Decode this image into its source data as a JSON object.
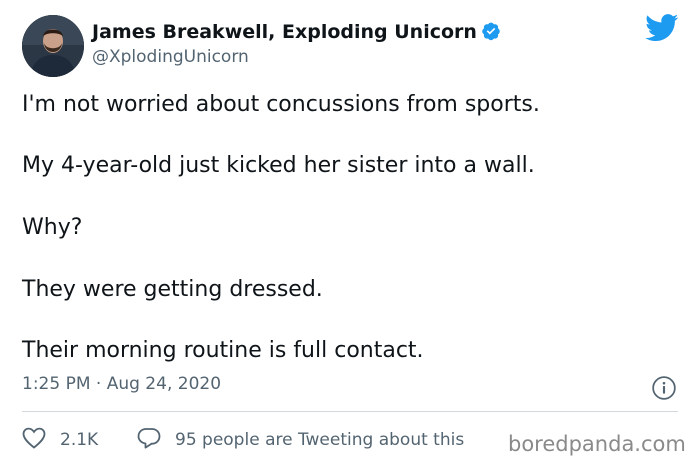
{
  "author": {
    "display_name": "James Breakwell, Exploding Unicorn",
    "handle": "@XplodingUnicorn",
    "verified_icon": "verified-badge-icon",
    "avatar_icon": "avatar"
  },
  "brand": {
    "icon": "twitter-bird-icon",
    "color": "#1d9bf0"
  },
  "tweet": {
    "lines": [
      "I'm not worried about concussions from sports.",
      "My 4-year-old just kicked her sister into a wall.",
      "Why?",
      "They were getting dressed.",
      "Their morning routine is full contact."
    ],
    "timestamp": "1:25 PM · Aug 24, 2020"
  },
  "actions": {
    "likes": {
      "count": "2.1K",
      "icon": "heart-icon"
    },
    "replies": {
      "text": "95 people are Tweeting about this",
      "icon": "reply-bubble-icon"
    },
    "info_icon": "info-icon"
  },
  "watermark": "boredpanda.com",
  "colors": {
    "text": "#0f1419",
    "secondary": "#536471",
    "divider": "#cfd9de"
  }
}
